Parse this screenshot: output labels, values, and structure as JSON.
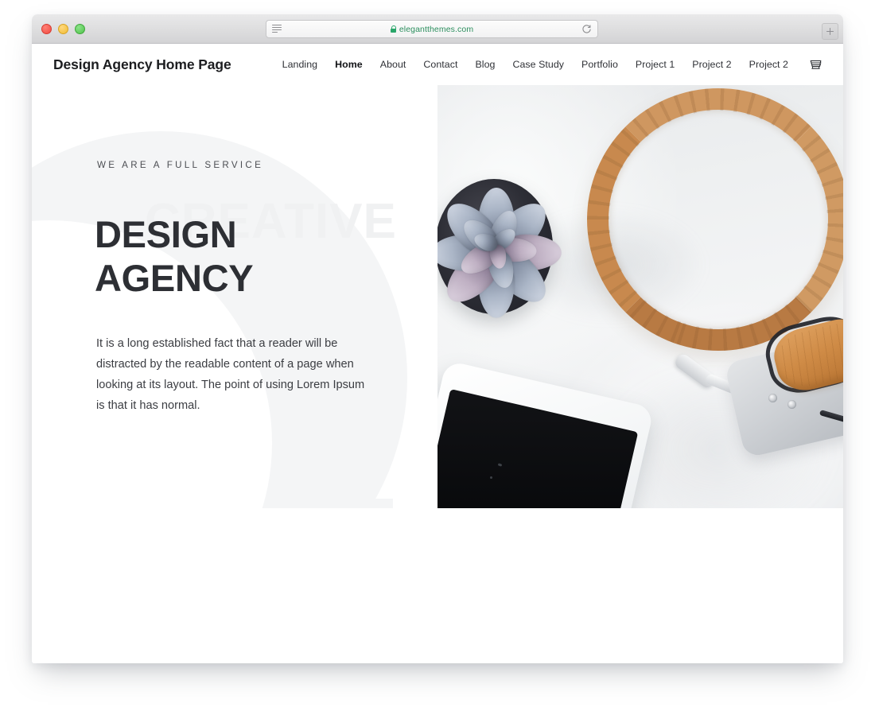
{
  "browser": {
    "traffic_lights": [
      {
        "name": "close",
        "color": "#f04a41"
      },
      {
        "name": "minimize",
        "color": "#f0bc33"
      },
      {
        "name": "maximize",
        "color": "#4fc24a"
      }
    ],
    "url": "elegantthemes.com",
    "secure": true,
    "reader_icon": "reader-view-icon",
    "reload_icon": "reload-icon",
    "new_tab_icon": "plus-icon"
  },
  "site": {
    "logo": "Design Agency Home Page",
    "nav": [
      {
        "label": "Landing",
        "active": false
      },
      {
        "label": "Home",
        "active": true
      },
      {
        "label": "About",
        "active": false
      },
      {
        "label": "Contact",
        "active": false
      },
      {
        "label": "Blog",
        "active": false
      },
      {
        "label": "Case Study",
        "active": false
      },
      {
        "label": "Portfolio",
        "active": false
      },
      {
        "label": "Project 1",
        "active": false
      },
      {
        "label": "Project 2",
        "active": false
      },
      {
        "label": "Project 2",
        "active": false
      }
    ],
    "cart_icon": "shopping-cart-icon"
  },
  "hero": {
    "watermark": "CREATIVE",
    "eyebrow": "WE ARE A FULL SERVICE",
    "title": "DESIGN\nAGENCY",
    "paragraph": "It is a long established fact that a reader will be distracted by the readable content of a page when looking at its layout. The point of using Lorem Ipsum is that it has normal.",
    "image_alt": "Flat-lay photo of a succulent plant in a dark pot, tan leather over-ear headphones and a white smartphone on a white surface"
  },
  "colors": {
    "heading": "#2d2f34",
    "body_text": "#3b3d42",
    "eyebrow": "#4b4d52",
    "blob": "#f4f5f6",
    "watermark": "#f0f1f2",
    "secure_green": "#2c8f5e",
    "page_bg": "#ffffff"
  }
}
